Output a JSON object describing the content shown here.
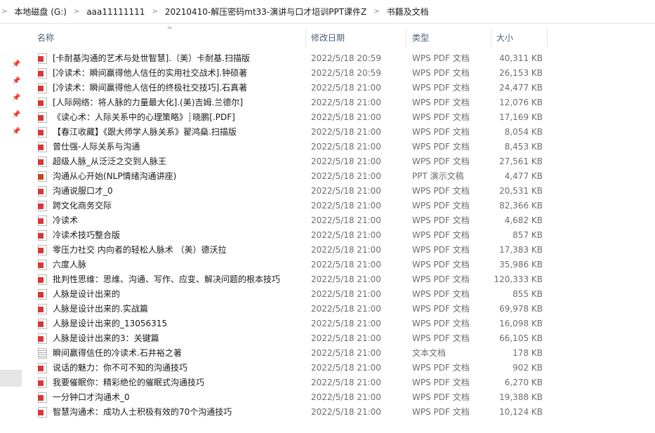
{
  "breadcrumb": [
    "本地磁盘 (G:)",
    "aaa11111111",
    "20210410-解压密码mt33-演讲与口才培训PPT课件Z",
    "书籍及文档"
  ],
  "columns": {
    "name": "名称",
    "date": "修改日期",
    "type": "类型",
    "size": "大小"
  },
  "files": [
    {
      "name": "[卡耐基沟通的艺术与处世智慧].（美）卡耐基.扫描版",
      "date": "2022/5/18 20:59",
      "type": "WPS PDF 文档",
      "size": "40,311 KB",
      "icon": "pdf"
    },
    {
      "name": "[冷读术：瞬间赢得他人信任的实用社交战术].钟硕著",
      "date": "2022/5/18 20:59",
      "type": "WPS PDF 文档",
      "size": "26,153 KB",
      "icon": "pdf"
    },
    {
      "name": "[冷读术：瞬间赢得他人信任的终极社交技巧].石真著",
      "date": "2022/5/18 21:00",
      "type": "WPS PDF 文档",
      "size": "24,477 KB",
      "icon": "pdf"
    },
    {
      "name": "[人际网络：将人脉的力量最大化].(美)吉姆.兰德尔]",
      "date": "2022/5/18 21:00",
      "type": "WPS PDF 文档",
      "size": "12,076 KB",
      "icon": "pdf"
    },
    {
      "name": "《读心术：人际关系中的心理策略》┊晓鹏[.PDF]",
      "date": "2022/5/18 21:00",
      "type": "WPS PDF 文档",
      "size": "17,169 KB",
      "icon": "pdf"
    },
    {
      "name": "【春江收藏】《跟大师学人脉关系》翟鸿燊.扫描版",
      "date": "2022/5/18 21:00",
      "type": "WPS PDF 文档",
      "size": "8,054 KB",
      "icon": "pdf"
    },
    {
      "name": "曾仕强-人际关系与沟通",
      "date": "2022/5/18 21:00",
      "type": "WPS PDF 文档",
      "size": "8,453 KB",
      "icon": "pdf"
    },
    {
      "name": "超级人脉_从泛泛之交到人脉王",
      "date": "2022/5/18 21:00",
      "type": "WPS PDF 文档",
      "size": "27,561 KB",
      "icon": "pdf"
    },
    {
      "name": "沟通从心开始(NLP情绪沟通讲座)",
      "date": "2022/5/18 21:00",
      "type": "PPT 演示文稿",
      "size": "4,477 KB",
      "icon": "ppt"
    },
    {
      "name": "沟通说服口才_0",
      "date": "2022/5/18 21:00",
      "type": "WPS PDF 文档",
      "size": "20,531 KB",
      "icon": "pdf"
    },
    {
      "name": "跨文化商务交际",
      "date": "2022/5/18 21:00",
      "type": "WPS PDF 文档",
      "size": "82,366 KB",
      "icon": "pdf"
    },
    {
      "name": "冷读术",
      "date": "2022/5/18 21:00",
      "type": "WPS PDF 文档",
      "size": "4,682 KB",
      "icon": "pdf"
    },
    {
      "name": "冷读术技巧整合版",
      "date": "2022/5/18 21:00",
      "type": "WPS PDF 文档",
      "size": "857 KB",
      "icon": "pdf"
    },
    {
      "name": "零压力社交  内向者的轻松人脉术 （美）德沃拉",
      "date": "2022/5/18 21:00",
      "type": "WPS PDF 文档",
      "size": "17,383 KB",
      "icon": "pdf"
    },
    {
      "name": "六度人脉",
      "date": "2022/5/18 21:00",
      "type": "WPS PDF 文档",
      "size": "35,986 KB",
      "icon": "pdf"
    },
    {
      "name": "批判性思维：思维、沟通、写作、应变、解决问题的根本技巧",
      "date": "2022/5/18 21:00",
      "type": "WPS PDF 文档",
      "size": "120,333 KB",
      "icon": "pdf"
    },
    {
      "name": "人脉是设计出来的",
      "date": "2022/5/18 21:00",
      "type": "WPS PDF 文档",
      "size": "855 KB",
      "icon": "pdf"
    },
    {
      "name": "人脉是设计出来的.实战篇",
      "date": "2022/5/18 21:00",
      "type": "WPS PDF 文档",
      "size": "69,978 KB",
      "icon": "pdf"
    },
    {
      "name": "人脉是设计出来的_13056315",
      "date": "2022/5/18 21:00",
      "type": "WPS PDF 文档",
      "size": "16,098 KB",
      "icon": "pdf"
    },
    {
      "name": "人脉是设计出来的3：关键篇",
      "date": "2022/5/18 21:00",
      "type": "WPS PDF 文档",
      "size": "66,105 KB",
      "icon": "pdf"
    },
    {
      "name": "瞬间赢得信任的冷读术.石井裕之著",
      "date": "2022/5/18 21:00",
      "type": "文本文档",
      "size": "178 KB",
      "icon": "txt"
    },
    {
      "name": "说话的魅力：你不可不知的沟通技巧",
      "date": "2022/5/18 21:00",
      "type": "WPS PDF 文档",
      "size": "902 KB",
      "icon": "pdf"
    },
    {
      "name": "我要催眠你：精彩绝伦的催眠式沟通技巧",
      "date": "2022/5/18 21:00",
      "type": "WPS PDF 文档",
      "size": "6,270 KB",
      "icon": "pdf"
    },
    {
      "name": "一分钟口才沟通术_0",
      "date": "2022/5/18 21:00",
      "type": "WPS PDF 文档",
      "size": "19,388 KB",
      "icon": "pdf"
    },
    {
      "name": "智慧沟通术：成功人士积极有效的70个沟通技巧",
      "date": "2022/5/18 21:00",
      "type": "WPS PDF 文档",
      "size": "10,124 KB",
      "icon": "pdf"
    }
  ]
}
